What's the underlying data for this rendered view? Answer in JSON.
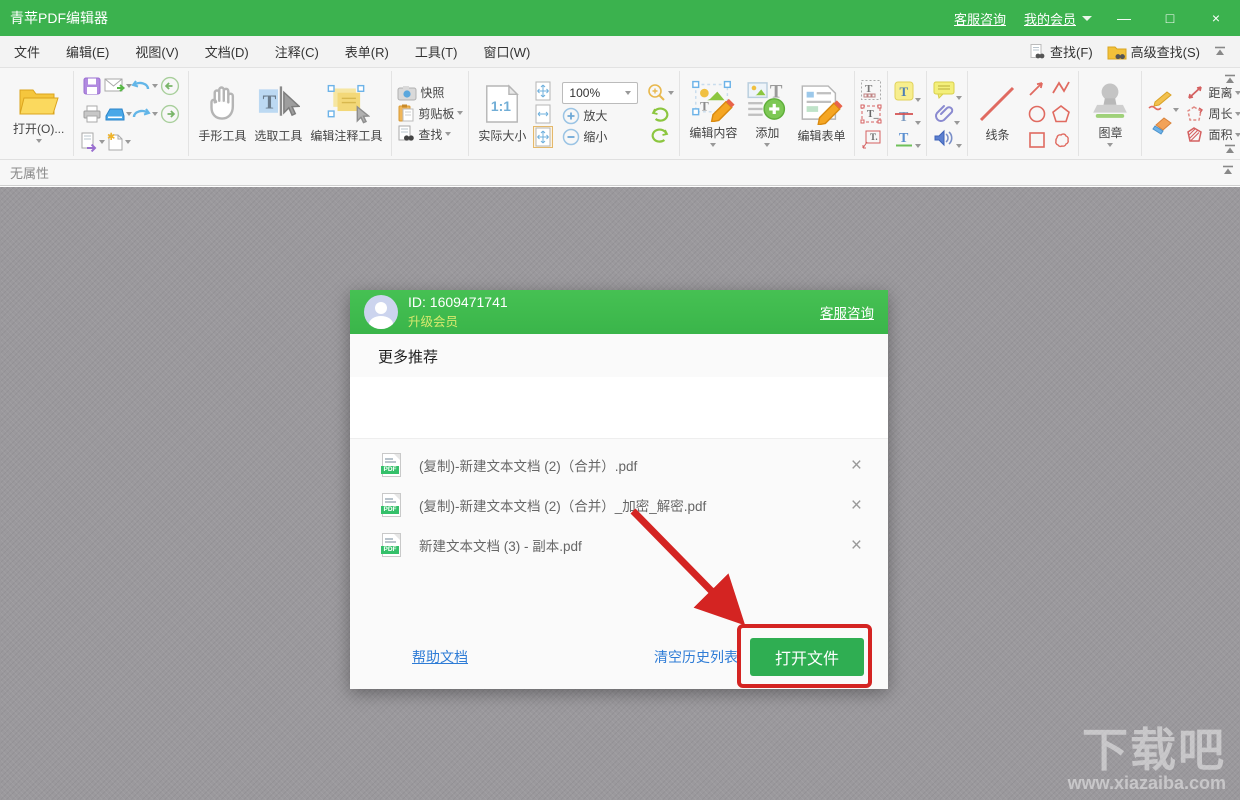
{
  "title_bar": {
    "app_title": "青苹PDF编辑器",
    "support_link": "客服咨询",
    "member_link": "我的会员",
    "minimize": "—",
    "maximize": "□",
    "close": "×"
  },
  "menu_bar": {
    "items": [
      {
        "label": "文件"
      },
      {
        "label": "编辑(E)"
      },
      {
        "label": "视图(V)"
      },
      {
        "label": "文档(D)"
      },
      {
        "label": "注释(C)"
      },
      {
        "label": "表单(R)"
      },
      {
        "label": "工具(T)"
      },
      {
        "label": "窗口(W)"
      }
    ],
    "find_label": "查找(F)",
    "advanced_find_label": "高级查找(S)"
  },
  "toolbar": {
    "open_label": "打开(O)...",
    "hand_tool_label": "手形工具",
    "select_tool_label": "选取工具",
    "edit_annotation_label": "编辑注释工具",
    "snapshot_label": "快照",
    "clipboard_label": "剪贴板",
    "find_label": "查找",
    "actual_size_label": "实际大小",
    "zoom_value": "100%",
    "zoom_in_label": "放大",
    "zoom_out_label": "缩小",
    "edit_content_label": "编辑内容",
    "add_label": "添加",
    "edit_form_label": "编辑表单",
    "line_label": "线条",
    "stamp_label": "图章",
    "distance_label": "距离",
    "perimeter_label": "周长",
    "area_label": "面积"
  },
  "property_bar": {
    "label": "无属性"
  },
  "dialog": {
    "user_id": "ID: 1609471741",
    "upgrade_link": "升级会员",
    "support_link": "客服咨询",
    "more_title": "更多推荐",
    "pdf_badge": "PDF",
    "remove_symbol": "×",
    "files": [
      {
        "name": "(复制)-新建文本文档 (2)（合并）.pdf"
      },
      {
        "name": "(复制)-新建文本文档 (2)（合并）_加密_解密.pdf"
      },
      {
        "name": "新建文本文档 (3) - 副本.pdf"
      }
    ],
    "help_link": "帮助文档",
    "clear_history_link": "清空历史列表",
    "open_button": "打开文件"
  },
  "watermark": {
    "text": "下载吧",
    "url": "www.xiazaiba.com"
  },
  "colors": {
    "titlebar_green": "#3bb24e",
    "dialog_header_green": "#3ab54a",
    "button_green": "#2fae52",
    "annotation_red": "#d42422",
    "link_blue": "#2e7cd6"
  }
}
